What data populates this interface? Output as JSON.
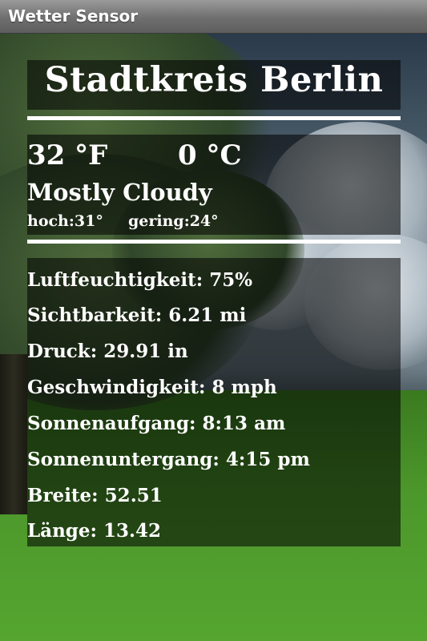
{
  "app": {
    "title": "Wetter Sensor"
  },
  "location": {
    "name": "Stadtkreis Berlin"
  },
  "current": {
    "temp_f": "32 °F",
    "temp_c": "0 °C",
    "condition": "Mostly Cloudy",
    "high": "hoch:31°",
    "low": "gering:24°"
  },
  "details": [
    {
      "text": "Luftfeuchtigkeit: 75%"
    },
    {
      "text": "Sichtbarkeit: 6.21 mi"
    },
    {
      "text": "Druck: 29.91 in"
    },
    {
      "text": "Geschwindigkeit: 8 mph"
    },
    {
      "text": "Sonnenaufgang: 8:13 am"
    },
    {
      "text": "Sonnenuntergang: 4:15 pm"
    },
    {
      "text": "Breite: 52.51"
    },
    {
      "text": "Länge: 13.42"
    }
  ]
}
